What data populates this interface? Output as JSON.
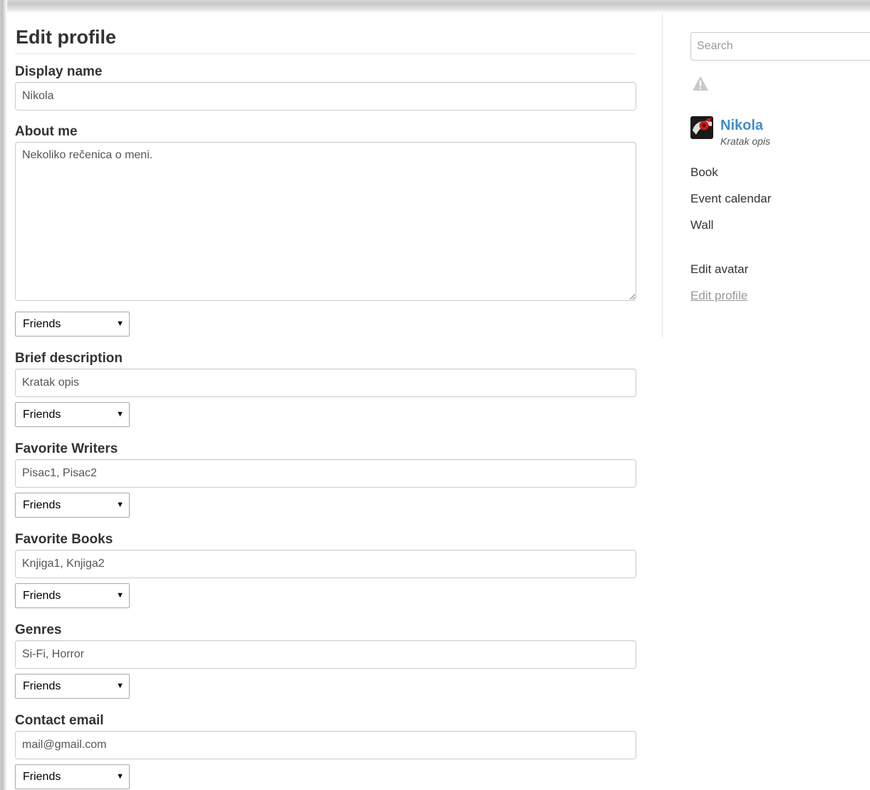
{
  "page": {
    "title": "Edit profile"
  },
  "form": {
    "display_name": {
      "label": "Display name",
      "value": "Nikola"
    },
    "about_me": {
      "label": "About me",
      "value": "Nekoliko rečenica o meni.",
      "visibility": "Friends"
    },
    "brief_description": {
      "label": "Brief description",
      "value": "Kratak opis",
      "visibility": "Friends"
    },
    "favorite_writers": {
      "label": "Favorite Writers",
      "value": "Pisac1, Pisac2",
      "visibility": "Friends"
    },
    "favorite_books": {
      "label": "Favorite Books",
      "value": "Knjiga1, Knjiga2",
      "visibility": "Friends"
    },
    "genres": {
      "label": "Genres",
      "value": "Si-Fi, Horror",
      "visibility": "Friends"
    },
    "contact_email": {
      "label": "Contact email",
      "value": "mail@gmail.com",
      "visibility": "Friends"
    }
  },
  "sidebar": {
    "search": {
      "placeholder": "Search",
      "value": ""
    },
    "warning_icon": "warning-triangle-icon",
    "profile": {
      "name": "Nikola",
      "description": "Kratak opis"
    },
    "nav": [
      {
        "label": "Book"
      },
      {
        "label": "Event calendar"
      },
      {
        "label": "Wall"
      },
      {
        "label": "Edit avatar"
      },
      {
        "label": "Edit profile",
        "active": true
      }
    ]
  },
  "colors": {
    "link": "#428bca",
    "text": "#333333",
    "muted": "#999999",
    "border": "#cccccc"
  }
}
